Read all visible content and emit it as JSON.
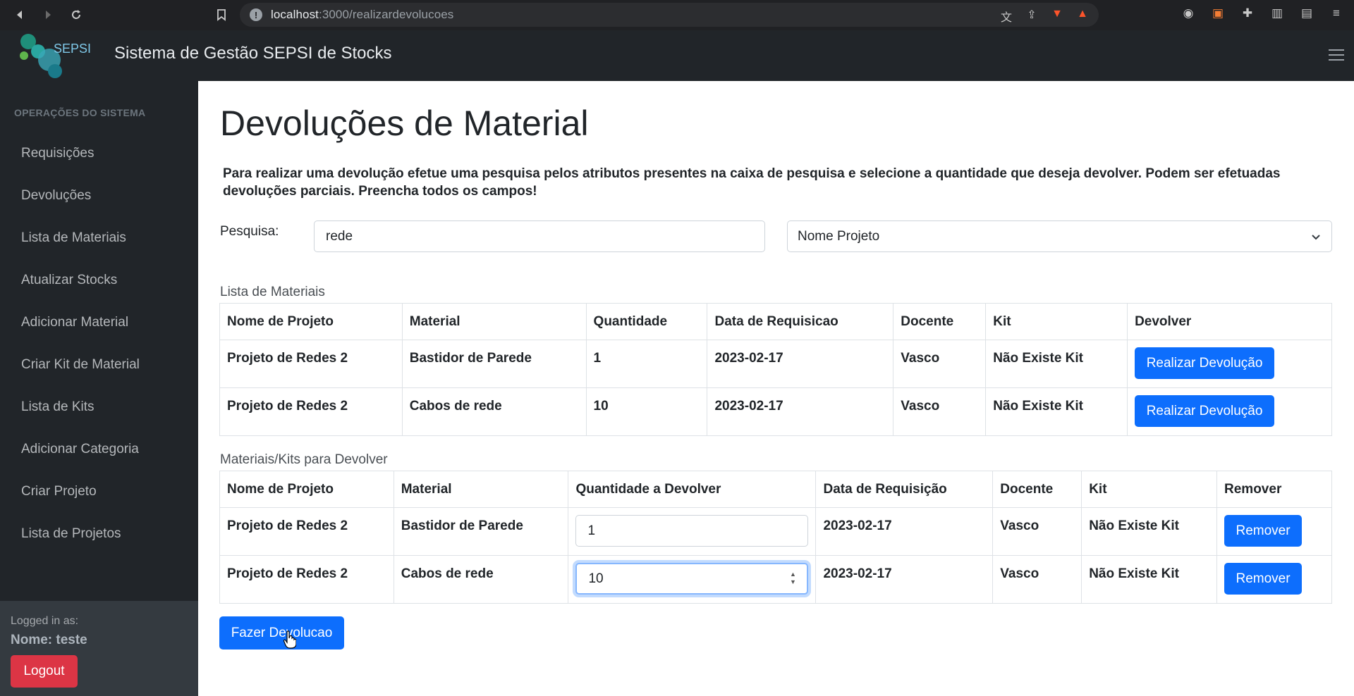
{
  "browser": {
    "url_host": "localhost",
    "url_path": ":3000/realizardevolucoes"
  },
  "header": {
    "brand": "Sistema de Gestão SEPSI de Stocks",
    "logo_text": "SEPSI"
  },
  "sidebar": {
    "heading": "OPERAÇÕES DO SISTEMA",
    "items": [
      {
        "label": "Requisições"
      },
      {
        "label": "Devoluções"
      },
      {
        "label": "Lista de Materiais"
      },
      {
        "label": "Atualizar Stocks"
      },
      {
        "label": "Adicionar Material"
      },
      {
        "label": "Criar Kit de Material"
      },
      {
        "label": "Lista de Kits"
      },
      {
        "label": "Adicionar Categoria"
      },
      {
        "label": "Criar Projeto"
      },
      {
        "label": "Lista de Projetos"
      }
    ],
    "logged_label": "Logged in as:",
    "logged_name": "Nome: teste",
    "logout": "Logout"
  },
  "main": {
    "title": "Devoluções de Material",
    "intro": "Para realizar uma devolução efetue uma pesquisa pelos atributos presentes na caixa de pesquisa e selecione a quantidade que deseja devolver. Podem ser efetuadas devoluções parciais. Preencha todos os campos!",
    "search_label": "Pesquisa:",
    "search_value": "rede",
    "select_value": "Nome Projeto",
    "materials_caption": "Lista de Materiais",
    "materials_headers": [
      "Nome de Projeto",
      "Material",
      "Quantidade",
      "Data de Requisicao",
      "Docente",
      "Kit",
      "Devolver"
    ],
    "materials_rows": [
      {
        "projeto": "Projeto de Redes 2",
        "material": "Bastidor de Parede",
        "quantidade": "1",
        "data": "2023-02-17",
        "docente": "Vasco",
        "kit": "Não Existe Kit",
        "action": "Realizar Devolução"
      },
      {
        "projeto": "Projeto de Redes 2",
        "material": "Cabos de rede",
        "quantidade": "10",
        "data": "2023-02-17",
        "docente": "Vasco",
        "kit": "Não Existe Kit",
        "action": "Realizar Devolução"
      }
    ],
    "return_caption": "Materiais/Kits para Devolver",
    "return_headers": [
      "Nome de Projeto",
      "Material",
      "Quantidade a Devolver",
      "Data de Requisição",
      "Docente",
      "Kit",
      "Remover"
    ],
    "return_rows": [
      {
        "projeto": "Projeto de Redes 2",
        "material": "Bastidor de Parede",
        "quantidade": "1",
        "data": "2023-02-17",
        "docente": "Vasco",
        "kit": "Não Existe Kit",
        "action": "Remover"
      },
      {
        "projeto": "Projeto de Redes 2",
        "material": "Cabos de rede",
        "quantidade": "10",
        "data": "2023-02-17",
        "docente": "Vasco",
        "kit": "Não Existe Kit",
        "action": "Remover"
      }
    ],
    "submit": "Fazer Devolucao"
  },
  "colors": {
    "primary": "#0d6efd",
    "danger": "#dc3545",
    "dark": "#212529"
  }
}
